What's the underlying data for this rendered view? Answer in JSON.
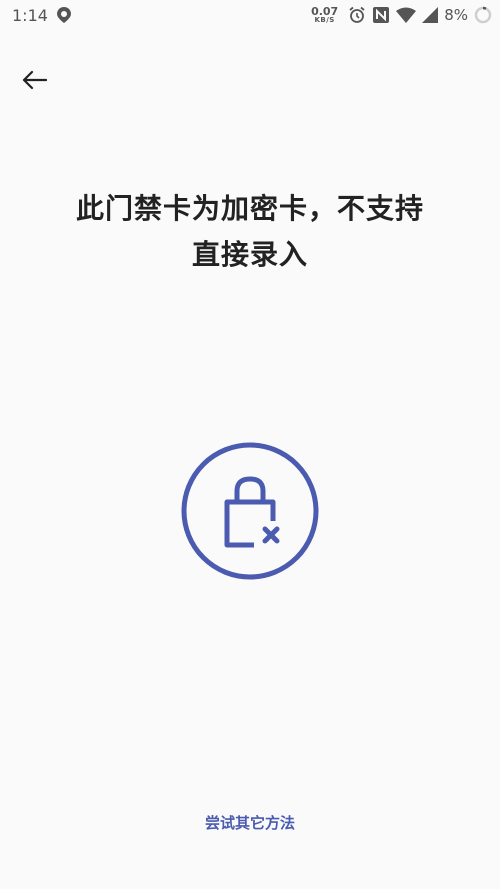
{
  "status_bar": {
    "time": "1:14",
    "net_speed_value": "0.07",
    "net_speed_unit": "KB/S",
    "battery_percent": "8%",
    "icons": [
      "location-icon",
      "alarm-icon",
      "nfc-icon",
      "wifi-icon",
      "signal-icon",
      "battery-icon"
    ]
  },
  "header": {
    "back_icon": "arrow-left-icon"
  },
  "main": {
    "title_line1": "此门禁卡为加密卡，不支持",
    "title_line2": "直接录入",
    "illustration_icon": "lock-x-icon",
    "accent_color": "#4a5bb0"
  },
  "footer": {
    "alt_method_label": "尝试其它方法"
  }
}
